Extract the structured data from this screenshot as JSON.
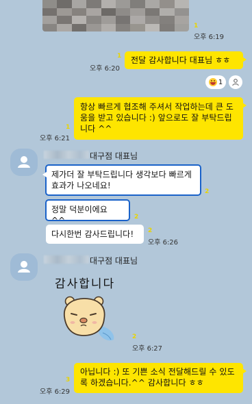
{
  "messages": {
    "m1": {
      "time": "오후 6:19",
      "unread": "1"
    },
    "m2": {
      "text": "전달 감사합니다 대표님 ㅎㅎ",
      "time": "오후 6:20",
      "unread": "1"
    },
    "reaction": {
      "emoji_icon": "grinning-face-icon",
      "count": "1",
      "user_icon": "person-outline-icon"
    },
    "m3": {
      "text": "항상 빠르게 협조해 주셔서 작업하는데 큰 도움을 받고 있습니다 :) 앞으로도 잘 부탁드립니다 ^^",
      "time": "오후 6:21",
      "unread": "1"
    },
    "sender1": {
      "name": "대구점 대표님"
    },
    "m4": {
      "text": "제가더 잘 부탁드립니다 생각보다 빠르게 효과가 나오네요!",
      "unread": "2"
    },
    "m5": {
      "text": "정말 덕분이에요 ^^",
      "unread": "2"
    },
    "m6": {
      "text": "다시한번 감사드립니다!",
      "time": "오후 6:26",
      "unread": "2"
    },
    "sender2": {
      "name": "대구점 대표님"
    },
    "sticker": {
      "text": "감사합니다",
      "icon": "bear-sticker-icon",
      "time": "오후 6:27",
      "unread": "2"
    },
    "m7": {
      "text": "아닙니다 :) 또 기쁜 소식 전달해드릴 수 있도록 하겠습니다.^^ 감사합니다 ㅎㅎ",
      "time": "오후 6:29",
      "unread": "3"
    }
  },
  "colors": {
    "background": "#b2c7d9",
    "my_bubble": "#fee500",
    "their_bubble": "#ffffff",
    "highlight": "#1a62c9"
  }
}
